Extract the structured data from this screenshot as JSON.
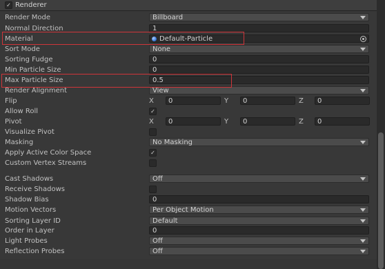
{
  "header": {
    "checked": "✓",
    "title": "Renderer"
  },
  "rows": {
    "render_mode": {
      "label": "Render Mode",
      "value": "Billboard"
    },
    "normal_direction": {
      "label": "Normal Direction",
      "value": "1"
    },
    "material": {
      "label": "Material",
      "value": "Default-Particle"
    },
    "sort_mode": {
      "label": "Sort Mode",
      "value": "None"
    },
    "sorting_fudge": {
      "label": "Sorting Fudge",
      "value": "0"
    },
    "min_particle_size": {
      "label": "Min Particle Size",
      "value": "0"
    },
    "max_particle_size": {
      "label": "Max Particle Size",
      "value": "0.5"
    },
    "render_alignment": {
      "label": "Render Alignment",
      "value": "View"
    },
    "flip": {
      "label": "Flip",
      "x": "0",
      "y": "0",
      "z": "0"
    },
    "allow_roll": {
      "label": "Allow Roll",
      "checked": "✓"
    },
    "pivot": {
      "label": "Pivot",
      "x": "0",
      "y": "0",
      "z": "0"
    },
    "visualize_pivot": {
      "label": "Visualize Pivot",
      "checked": ""
    },
    "masking": {
      "label": "Masking",
      "value": "No Masking"
    },
    "apply_active_color_space": {
      "label": "Apply Active Color Space",
      "checked": "✓"
    },
    "custom_vertex_streams": {
      "label": "Custom Vertex Streams",
      "checked": ""
    },
    "cast_shadows": {
      "label": "Cast Shadows",
      "value": "Off"
    },
    "receive_shadows": {
      "label": "Receive Shadows",
      "checked": ""
    },
    "shadow_bias": {
      "label": "Shadow Bias",
      "value": "0"
    },
    "motion_vectors": {
      "label": "Motion Vectors",
      "value": "Per Object Motion"
    },
    "sorting_layer_id": {
      "label": "Sorting Layer ID",
      "value": "Default"
    },
    "order_in_layer": {
      "label": "Order in Layer",
      "value": "0"
    },
    "light_probes": {
      "label": "Light Probes",
      "value": "Off"
    },
    "reflection_probes": {
      "label": "Reflection Probes",
      "value": "Off"
    }
  },
  "axes": {
    "x": "X",
    "y": "Y",
    "z": "Z"
  },
  "colors": {
    "highlight": "#d0353a",
    "background": "#383838",
    "field": "#2a2a2a"
  }
}
